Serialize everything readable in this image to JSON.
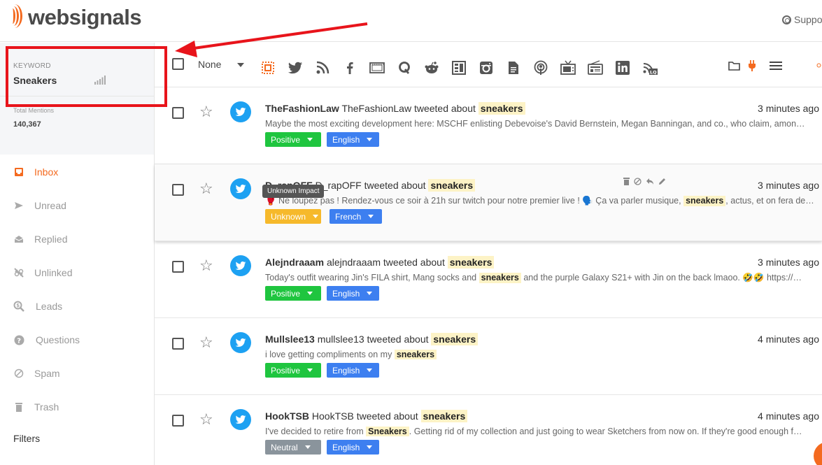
{
  "header": {
    "logo_text": "websignals",
    "support_label": "Suppo"
  },
  "sidebar": {
    "keyword_label": "KEYWORD",
    "keyword_value": "Sneakers",
    "total_mentions_label": "Total Mentions",
    "total_mentions_value": "140,367",
    "items": [
      {
        "label": "Inbox",
        "icon": "inbox-icon",
        "active": true
      },
      {
        "label": "Unread",
        "icon": "send-icon"
      },
      {
        "label": "Replied",
        "icon": "envelope-open-icon"
      },
      {
        "label": "Unlinked",
        "icon": "unlink-icon"
      },
      {
        "label": "Leads",
        "icon": "dollar-search-icon"
      },
      {
        "label": "Questions",
        "icon": "question-icon"
      },
      {
        "label": "Spam",
        "icon": "ban-icon"
      },
      {
        "label": "Trash",
        "icon": "trash-icon"
      }
    ],
    "filters_label": "Filters"
  },
  "toolbar": {
    "select_label": "None",
    "sources": [
      "all-sources-icon",
      "twitter-icon",
      "rss-icon",
      "facebook-icon",
      "video-icon",
      "quora-icon",
      "reddit-icon",
      "forum-icon",
      "instagram-icon",
      "document-icon",
      "podcast-icon",
      "tv-icon",
      "radio-icon",
      "linkedin-icon",
      "rss-lq-icon"
    ],
    "accent": "#f46a1f"
  },
  "mentions": [
    {
      "author": "TheFashionLaw",
      "handle_text": "TheFashionLaw tweeted about",
      "keyword": "sneakers",
      "time": "3 minutes ago",
      "snippet": "Maybe the most exciting development here: MSCHF enlisting Debevoise's David Bernstein, Megan Banningan, and co., who claim, amon…",
      "sentiment": "Positive",
      "language": "English"
    },
    {
      "author": "D_rapOFF",
      "handle_text": "D_rapOFF tweeted about",
      "keyword": "sneakers",
      "time": "3 minutes ago",
      "snippet_pre": "🥊 Ne loupez pas ! Rendez-vous ce soir à 21h sur twitch pour notre premier live ! 🗣️ Ça va parler musique,",
      "snippet_kw": "sneakers",
      "snippet_post": ", actus, et on fera de…",
      "sentiment": "Unknown",
      "language": "French",
      "tooltip": "Unknown Impact"
    },
    {
      "author": "Alejndraaam",
      "handle_text": "alejndraaam tweeted about",
      "keyword": "sneakers",
      "time": "3 minutes ago",
      "snippet_pre": "Today's outfit wearing Jin's FILA shirt, Mang socks and",
      "snippet_kw": "sneakers",
      "snippet_post": "and the purple Galaxy S21+ with Jin on the back lmaoo. 🤣🤣 https://…",
      "sentiment": "Positive",
      "language": "English"
    },
    {
      "author": "Mullslee13",
      "handle_text": "mullslee13 tweeted about",
      "keyword": "sneakers",
      "time": "4 minutes ago",
      "snippet_pre": "i love getting compliments on my",
      "snippet_kw": "sneakers",
      "snippet_post": "",
      "sentiment": "Positive",
      "language": "English"
    },
    {
      "author": "HookTSB",
      "handle_text": "HookTSB tweeted about",
      "keyword": "sneakers",
      "time": "4 minutes ago",
      "snippet_pre": "I've decided to retire from",
      "snippet_kw": "Sneakers",
      "snippet_post": ". Getting rid of my collection and just going to wear Sketchers from now on. If they're good enough f…",
      "sentiment": "Neutral",
      "language": "English"
    }
  ],
  "colors": {
    "positive": "#1fc53f",
    "unknown": "#f6b92b",
    "neutral": "#8a949c",
    "language": "#3d7ff0",
    "twitter": "#1da1f2",
    "annotation_red": "#e8141b"
  }
}
